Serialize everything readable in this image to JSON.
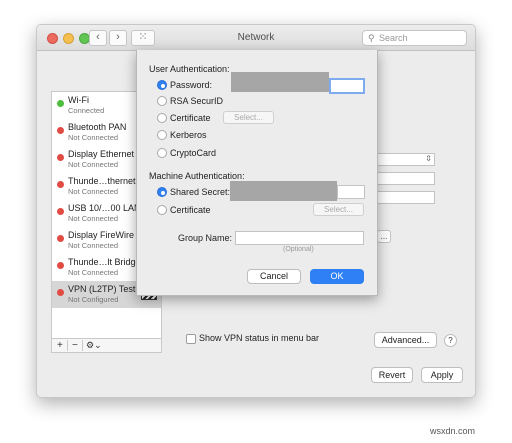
{
  "window": {
    "title": "Network",
    "back_glyph": "‹",
    "forward_glyph": "›",
    "grid_glyph": "⁙",
    "search": {
      "placeholder": "Search",
      "icon": "magnifier-icon"
    }
  },
  "sidebar": {
    "items": [
      {
        "name": "Wi-Fi",
        "status": "Connected",
        "status_color": "#4cbd3c"
      },
      {
        "name": "Bluetooth PAN",
        "status": "Not Connected",
        "status_color": "#e04b43"
      },
      {
        "name": "Display Ethernet",
        "status": "Not Connected",
        "status_color": "#e04b43"
      },
      {
        "name": "Thunde…thernet",
        "status": "Not Connected",
        "status_color": "#e04b43"
      },
      {
        "name": "USB 10/…00 LAN",
        "status": "Not Connected",
        "status_color": "#e04b43"
      },
      {
        "name": "Display FireWire",
        "status": "Not Connected",
        "status_color": "#e04b43"
      },
      {
        "name": "Thunde…lt Bridge",
        "status": "Not Connected",
        "status_color": "#e04b43"
      },
      {
        "name": "VPN (L2TP) Test",
        "status": "Not Configured",
        "status_color": "#e04b43"
      }
    ],
    "tools": {
      "add": "+",
      "remove": "−",
      "gear": "⚙⌄"
    }
  },
  "panel": {
    "show_vpn_status_label": "Show VPN status in menu bar",
    "advanced_label": "Advanced...",
    "help_label": "?",
    "revert_label": "Revert",
    "apply_label": "Apply",
    "ellipsis_button": "..."
  },
  "sheet": {
    "user_auth_heading": "User Authentication:",
    "user_options": [
      {
        "label": "Password:",
        "selected": true
      },
      {
        "label": "RSA SecurID",
        "selected": false
      },
      {
        "label": "Certificate",
        "selected": false
      },
      {
        "label": "Kerberos",
        "selected": false
      },
      {
        "label": "CryptoCard",
        "selected": false
      }
    ],
    "select_label": "Select...",
    "machine_auth_heading": "Machine Authentication:",
    "machine_options": [
      {
        "label": "Shared Secret:",
        "selected": true
      },
      {
        "label": "Certificate",
        "selected": false
      }
    ],
    "machine_select_label": "Select...",
    "group_name_label": "Group Name:",
    "group_name_hint": "(Optional)",
    "cancel_label": "Cancel",
    "ok_label": "OK"
  },
  "accent_color": "#2f7ff5",
  "watermark": "wsxdn.com"
}
